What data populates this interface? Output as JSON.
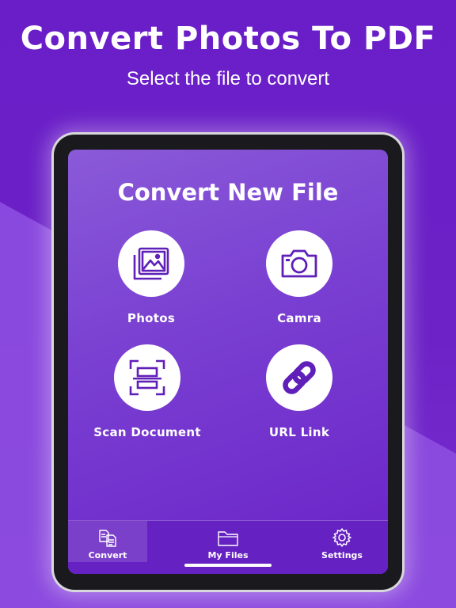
{
  "promo": {
    "headline": "Convert Photos To PDF",
    "subheadline": "Select the file to convert"
  },
  "app": {
    "title": "Convert New File",
    "options": [
      {
        "label": "Photos",
        "icon": "photos-icon"
      },
      {
        "label": "Camra",
        "icon": "camera-icon"
      },
      {
        "label": "Scan Document",
        "icon": "scan-icon"
      },
      {
        "label": "URL Link",
        "icon": "link-icon"
      }
    ],
    "tabs": [
      {
        "label": "Convert",
        "icon": "convert-icon",
        "active": true
      },
      {
        "label": "My Files",
        "icon": "folder-icon",
        "active": false
      },
      {
        "label": "Settings",
        "icon": "gear-icon",
        "active": false
      }
    ]
  },
  "colors": {
    "background": "#6a1fc4",
    "accent": "#6a1fc4",
    "tile_circle": "#ffffff",
    "text": "#ffffff"
  }
}
